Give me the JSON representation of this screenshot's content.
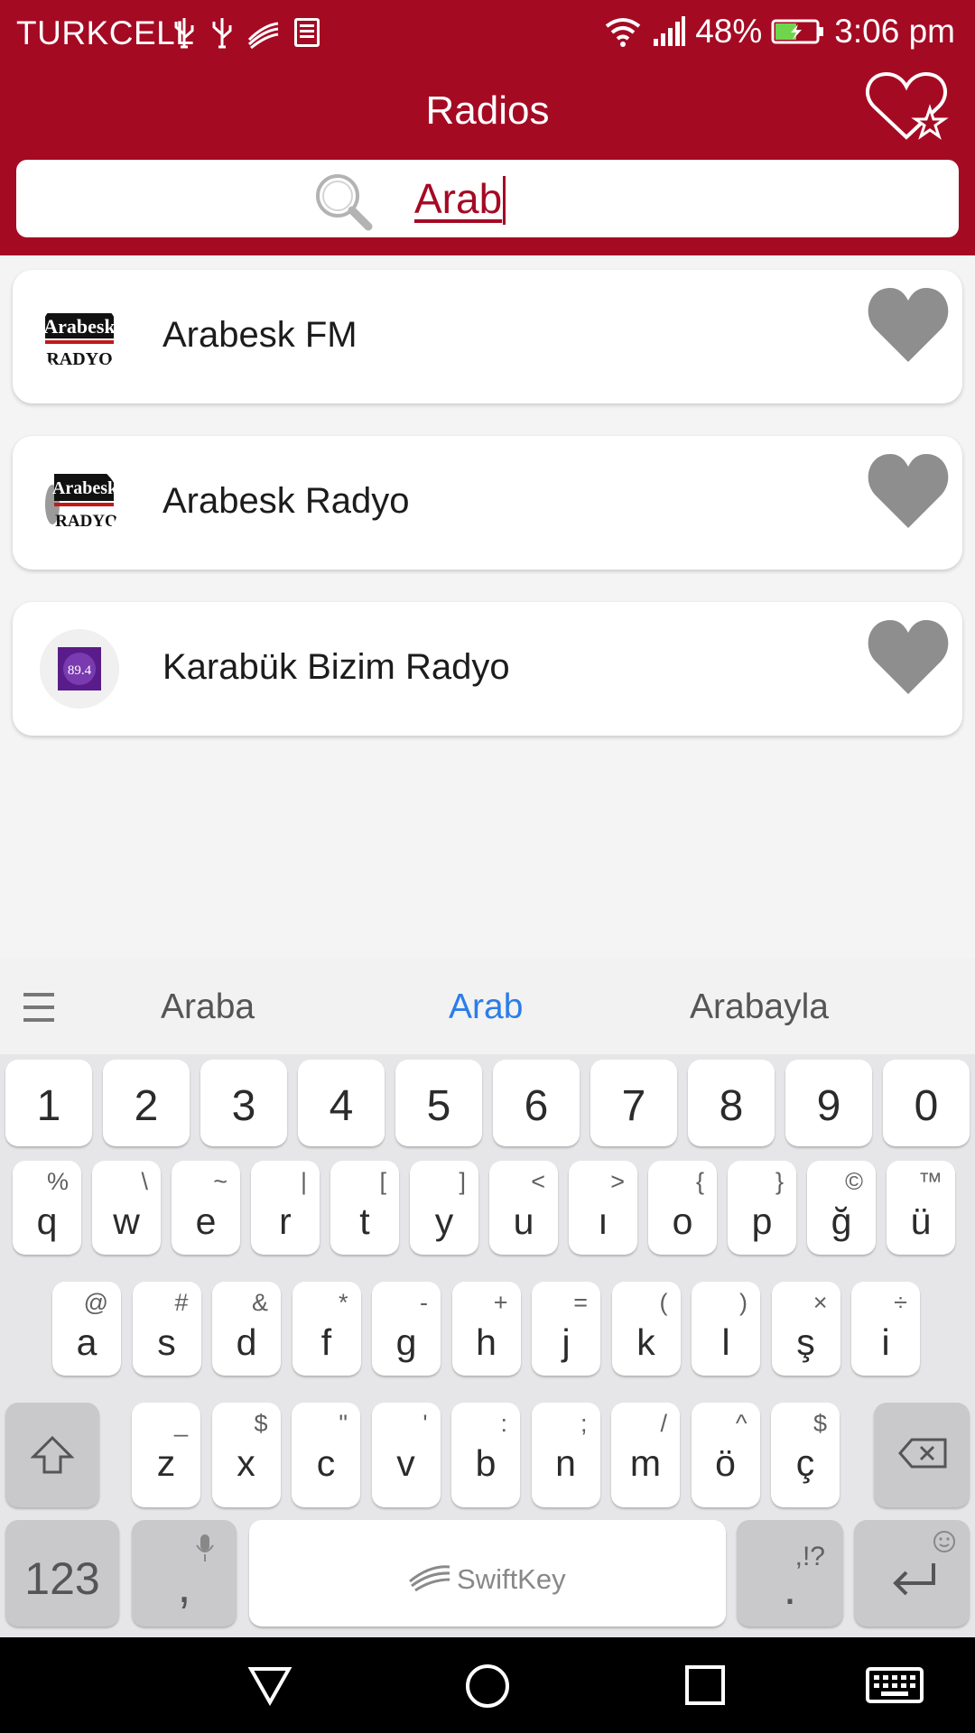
{
  "status_bar": {
    "carrier": "TURKCELL",
    "battery": "48%",
    "time": "3:06 pm"
  },
  "header": {
    "title": "Radios",
    "favorites_icon": "heart-star-icon"
  },
  "search": {
    "query": "Arab"
  },
  "stations": [
    {
      "name": "Arabesk FM",
      "logo_text_top": "Arabesk",
      "logo_text_bottom": "RADYO"
    },
    {
      "name": "Arabesk Radyo",
      "logo_text_top": "Arabesk",
      "logo_text_bottom": "RADYO"
    },
    {
      "name": "Karabük Bizim Radyo",
      "logo_text": "89.4"
    }
  ],
  "keyboard": {
    "suggestions": [
      "Araba",
      "Arab",
      "Arabayla"
    ],
    "number_row": [
      "1",
      "2",
      "3",
      "4",
      "5",
      "6",
      "7",
      "8",
      "9",
      "0"
    ],
    "row1": [
      [
        "q",
        "%"
      ],
      [
        "w",
        "\\"
      ],
      [
        "e",
        "~"
      ],
      [
        "r",
        "|"
      ],
      [
        "t",
        "["
      ],
      [
        "y",
        "]"
      ],
      [
        "u",
        "<"
      ],
      [
        "ı",
        ">"
      ],
      [
        "o",
        "{"
      ],
      [
        "p",
        "}"
      ],
      [
        "ğ",
        "©"
      ],
      [
        "ü",
        "™"
      ]
    ],
    "row2": [
      [
        "a",
        "@"
      ],
      [
        "s",
        "#"
      ],
      [
        "d",
        "&"
      ],
      [
        "f",
        "*"
      ],
      [
        "g",
        "-"
      ],
      [
        "h",
        "+"
      ],
      [
        "j",
        "="
      ],
      [
        "k",
        "("
      ],
      [
        "l",
        ")"
      ],
      [
        "ş",
        "×"
      ],
      [
        "i",
        "÷"
      ]
    ],
    "row3": [
      [
        "z",
        "_"
      ],
      [
        "x",
        "$"
      ],
      [
        "c",
        "\""
      ],
      [
        "v",
        "'"
      ],
      [
        "b",
        ":"
      ],
      [
        "n",
        ";"
      ],
      [
        "m",
        "/"
      ],
      [
        "ö",
        "^"
      ],
      [
        "ç",
        "$"
      ]
    ],
    "num_switch": "123",
    "comma": ",",
    "space_brand": "SwiftKey",
    "period": ".",
    "period_alt": ",!?"
  },
  "colors": {
    "brand": "#a50a23",
    "suggestion_active": "#2b7de9",
    "heart": "#8e8e8e"
  }
}
